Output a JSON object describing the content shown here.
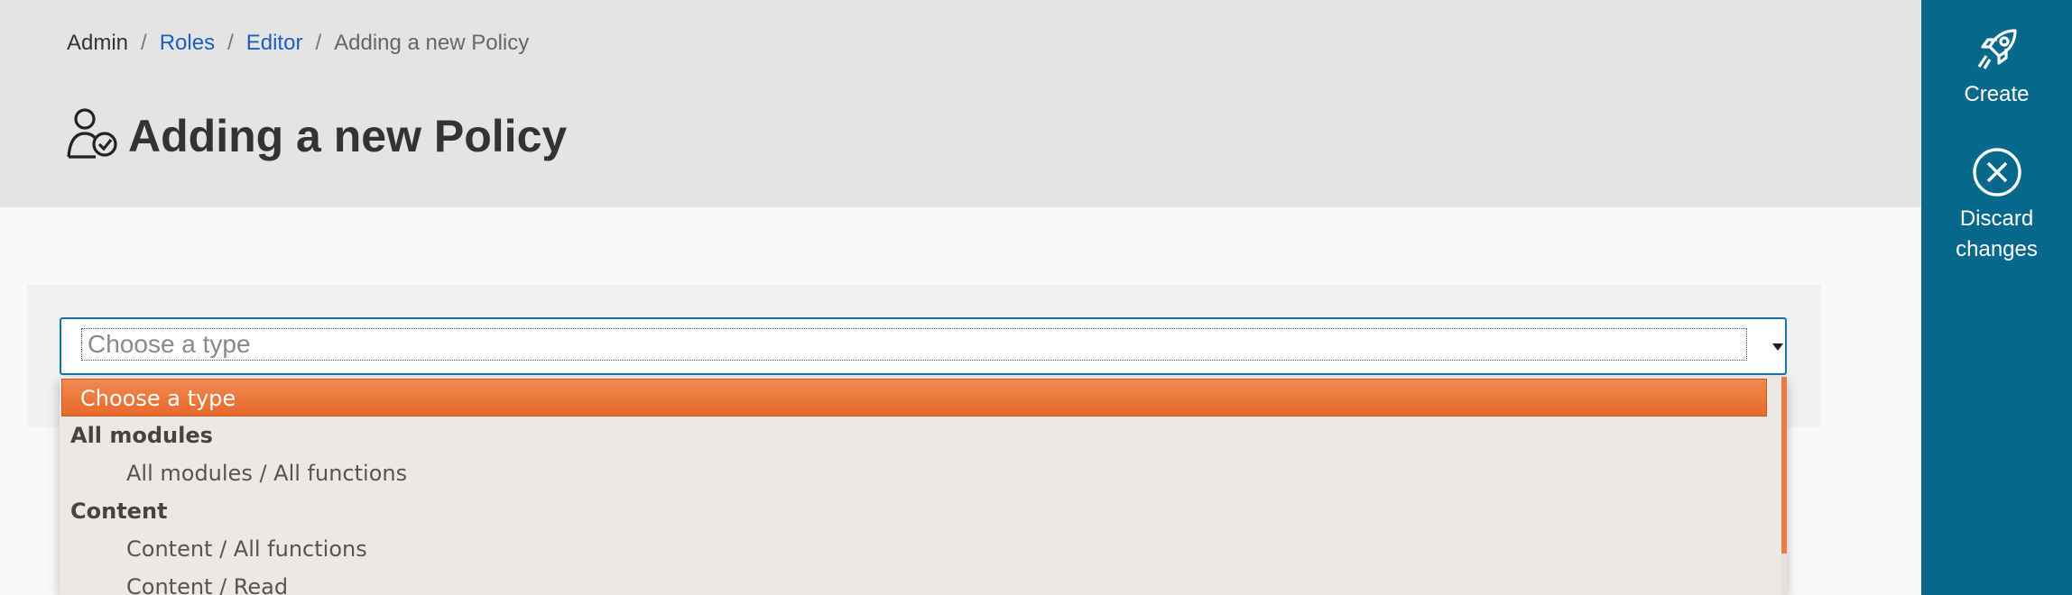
{
  "breadcrumb": {
    "items": [
      {
        "label": "Admin",
        "type": "plain"
      },
      {
        "label": "Roles",
        "type": "link"
      },
      {
        "label": "Editor",
        "type": "link"
      },
      {
        "label": "Adding a new Policy",
        "type": "current"
      }
    ],
    "separator": "/"
  },
  "page": {
    "title": "Adding a new Policy",
    "icon": "user-check-icon"
  },
  "sidebar": {
    "create_label": "Create",
    "create_icon": "rocket-icon",
    "discard_label_line1": "Discard",
    "discard_label_line2": "changes",
    "discard_icon": "circle-x-icon",
    "bg_color": "#06698c"
  },
  "type_select": {
    "placeholder": "Choose a type",
    "options": {
      "selected": "Choose a type",
      "groups": [
        {
          "label": "All modules",
          "items": [
            "All modules / All functions"
          ]
        },
        {
          "label": "Content",
          "items": [
            "Content / All functions",
            "Content / Read"
          ]
        }
      ]
    }
  },
  "colors": {
    "accent_orange": "#ec7a44",
    "link_blue": "#1c5ebf",
    "header_bg": "#e5e4e5"
  }
}
